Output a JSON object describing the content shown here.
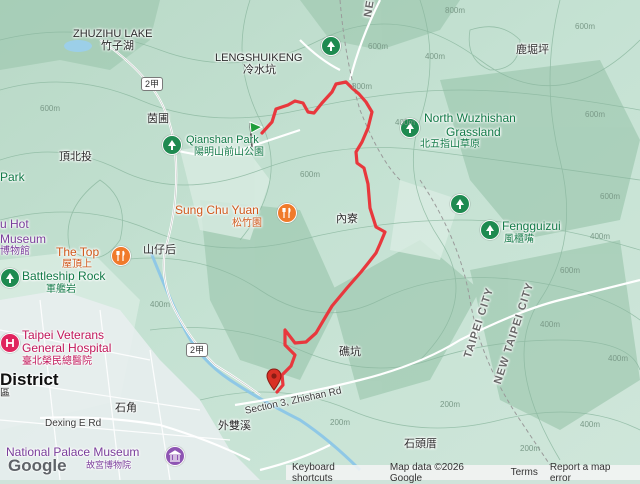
{
  "labels": {
    "zhuzihu_en": "ZHUZIHU LAKE",
    "zhuzihu_zh": "竹子湖",
    "lengshuikeng_en": "LENGSHUIKENG",
    "lengshuikeng_zh": "冷水坑",
    "new_taipei_top": "NEW T",
    "liuzaoping": "鹿堀坪",
    "qianshan_en": "Qianshan Park",
    "qianshan_zh": "陽明山前山公園",
    "qiepu": "茵圃",
    "dingbeitou": "頂北投",
    "park_left": "Park",
    "north_wuzhishan_1": "North Wuzhishan",
    "north_wuzhishan_2": "Grassland",
    "north_wuzhishan_zh": "北五指山草原",
    "sungchuyuan_en": "Sung Chu Yuan",
    "sungchuyuan_zh": "松竹園",
    "neiliao": "內寮",
    "hot_museum_1": "u Hot",
    "hot_museum_2": "Museum",
    "hot_museum_zh": "博物館",
    "the_top_en": "The Top",
    "the_top_zh": "屋頂上",
    "shanzaihou": "山仔后",
    "fengguizui_en": "Fengguizui",
    "fengguizui_zh": "風櫃嘴",
    "battleship_en": "Battleship Rock",
    "battleship_zh": "軍艦岩",
    "taipei_city": "TAIPEI CITY",
    "new_taipei_city": "NEW TAIPEI CITY",
    "veterans_1": "Taipei Veterans",
    "veterans_2": "General Hospital",
    "veterans_zh": "臺北榮民總醫院",
    "suikeng": "礁坑",
    "district_en": "District",
    "district_zh": "區",
    "shijiao": "石角",
    "zhishan_rd": "Section 3, Zhishan Rd",
    "dexing_rd": "Dexing E Rd",
    "waishuangxi": "外雙溪",
    "palace_museum_en": "National Palace Museum",
    "palace_museum_zh": "故宮博物院",
    "shitoucuo": "石頭厝"
  },
  "road_shields": [
    "2甲",
    "2甲"
  ],
  "elevations": [
    "600m",
    "600m",
    "400m",
    "800m",
    "600m",
    "400m",
    "400m",
    "800m",
    "600m",
    "400m",
    "200m",
    "600m",
    "200m",
    "400m",
    "200m",
    "600m",
    "600m",
    "400m",
    "400m"
  ],
  "footer": {
    "keyboard": "Keyboard shortcuts",
    "mapdata": "Map data ©2026 Google",
    "terms": "Terms",
    "report": "Report a map error"
  },
  "logo": "Google",
  "colors": {
    "route": "#e8383d",
    "start_marker": "#1e9e3a",
    "end_marker": "#d93025",
    "park_poi": "#1e8a50",
    "food_poi": "#f07a2a",
    "hospital_poi": "#e0245e",
    "museum_poi": "#8e55b3",
    "water": "#9ccfe8",
    "river": "#8fc8e6"
  },
  "icons": [
    "park-icon",
    "restaurant-icon",
    "hospital-icon",
    "museum-icon",
    "start-flag-icon",
    "end-pin-icon"
  ]
}
